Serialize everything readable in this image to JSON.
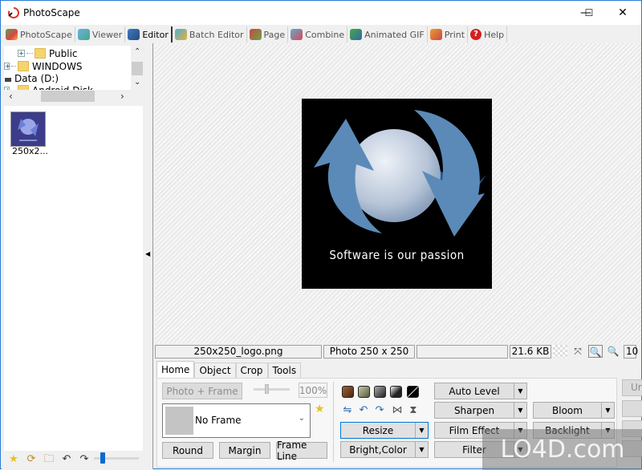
{
  "window": {
    "title": "PhotoScape",
    "controls": {
      "minimize": "—",
      "maximize": "☐",
      "close": "✕"
    }
  },
  "menu_tabs": [
    {
      "label": "PhotoScape",
      "icon": "photoscape-icon",
      "active": false
    },
    {
      "label": "Viewer",
      "icon": "viewer-icon",
      "active": false
    },
    {
      "label": "Editor",
      "icon": "editor-icon",
      "active": true
    },
    {
      "label": "Batch Editor",
      "icon": "batch-editor-icon",
      "active": false
    },
    {
      "label": "Page",
      "icon": "page-icon",
      "active": false
    },
    {
      "label": "Combine",
      "icon": "combine-icon",
      "active": false
    },
    {
      "label": "Animated GIF",
      "icon": "animated-gif-icon",
      "active": false
    },
    {
      "label": "Print",
      "icon": "print-icon",
      "active": false
    },
    {
      "label": "Help",
      "icon": "help-icon",
      "active": false
    }
  ],
  "tree": {
    "items": [
      {
        "label": "Public",
        "type": "folder",
        "expandable": true
      },
      {
        "label": "WINDOWS",
        "type": "folder",
        "expandable": true
      },
      {
        "label": "Data (D:)",
        "type": "drive",
        "expandable": false
      },
      {
        "label": "Android Disk",
        "type": "folder",
        "expandable": true
      }
    ]
  },
  "thumbnails": [
    {
      "label": "250x2..."
    }
  ],
  "left_toolbar": {
    "icons": [
      "favorite-star-icon",
      "refresh-icon",
      "browse-folder-icon",
      "back-arrow-icon",
      "forward-arrow-icon"
    ],
    "zoom_slider_value": 0.15
  },
  "photo": {
    "caption": "Software is our passion"
  },
  "status": {
    "filename": "250x250_logo.png",
    "info": "Photo 250 x 250",
    "extra": "",
    "filesize": "21.6 KB",
    "zoom": "10"
  },
  "editor_tabs": [
    {
      "label": "Home",
      "active": true
    },
    {
      "label": "Object",
      "active": false
    },
    {
      "label": "Crop",
      "active": false
    },
    {
      "label": "Tools",
      "active": false
    }
  ],
  "home_panel": {
    "photo_frame_button": "Photo + Frame",
    "frame_opacity": "100%",
    "frame_select": "No Frame",
    "round_button": "Round",
    "margin_button": "Margin",
    "frame_line_button": "Frame Line",
    "resize_button": "Resize",
    "bright_color_button": "Bright,Color",
    "auto_level_button": "Auto Level",
    "sharpen_button": "Sharpen",
    "film_effect_button": "Film Effect",
    "filter_button": "Filter",
    "bloom_button": "Bloom",
    "backlight_button": "Backlight",
    "undo_button": "Ur"
  },
  "swatch_colors": [
    "#6b3a1a",
    "#8a8a6a",
    "#666666",
    "#888888",
    "#111111"
  ],
  "watermark": "LO4D.com"
}
